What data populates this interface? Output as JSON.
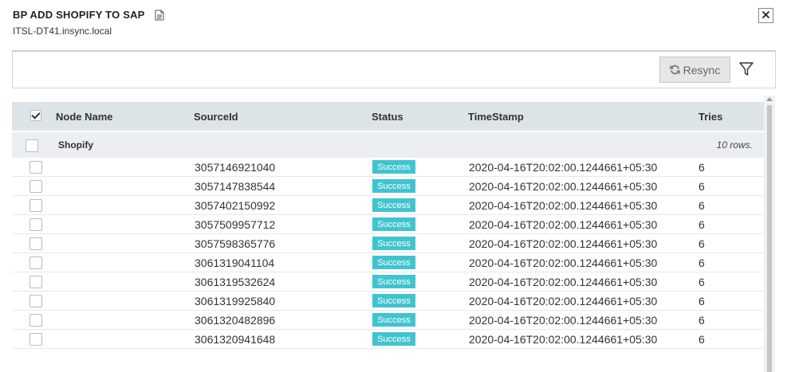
{
  "header": {
    "title": "BP ADD SHOPIFY TO SAP",
    "subtitle": "ITSL-DT41.insync.local",
    "title_icon": "document-icon",
    "close_icon": "close-icon"
  },
  "toolbar": {
    "resync_label": "Resync",
    "resync_icon": "refresh-icon",
    "filter_icon": "filter-icon"
  },
  "grid": {
    "columns": [
      "Node Name",
      "SourceId",
      "Status",
      "TimeStamp",
      "Tries"
    ],
    "group": {
      "name": "Shopify",
      "count_text": "10 rows."
    },
    "rows": [
      {
        "source_id": "3057146921040",
        "status": "Success",
        "timestamp": "2020-04-16T20:02:00.1244661+05:30",
        "tries": "6"
      },
      {
        "source_id": "3057147838544",
        "status": "Success",
        "timestamp": "2020-04-16T20:02:00.1244661+05:30",
        "tries": "6"
      },
      {
        "source_id": "3057402150992",
        "status": "Success",
        "timestamp": "2020-04-16T20:02:00.1244661+05:30",
        "tries": "6"
      },
      {
        "source_id": "3057509957712",
        "status": "Success",
        "timestamp": "2020-04-16T20:02:00.1244661+05:30",
        "tries": "6"
      },
      {
        "source_id": "3057598365776",
        "status": "Success",
        "timestamp": "2020-04-16T20:02:00.1244661+05:30",
        "tries": "6"
      },
      {
        "source_id": "3061319041104",
        "status": "Success",
        "timestamp": "2020-04-16T20:02:00.1244661+05:30",
        "tries": "6"
      },
      {
        "source_id": "3061319532624",
        "status": "Success",
        "timestamp": "2020-04-16T20:02:00.1244661+05:30",
        "tries": "6"
      },
      {
        "source_id": "3061319925840",
        "status": "Success",
        "timestamp": "2020-04-16T20:02:00.1244661+05:30",
        "tries": "6"
      },
      {
        "source_id": "3061320482896",
        "status": "Success",
        "timestamp": "2020-04-16T20:02:00.1244661+05:30",
        "tries": "6"
      },
      {
        "source_id": "3061320941648",
        "status": "Success",
        "timestamp": "2020-04-16T20:02:00.1244661+05:30",
        "tries": "6"
      }
    ]
  },
  "colors": {
    "success_badge": "#40c4cf",
    "header_bg": "#dde4e8",
    "group_bg": "#eceff1"
  }
}
